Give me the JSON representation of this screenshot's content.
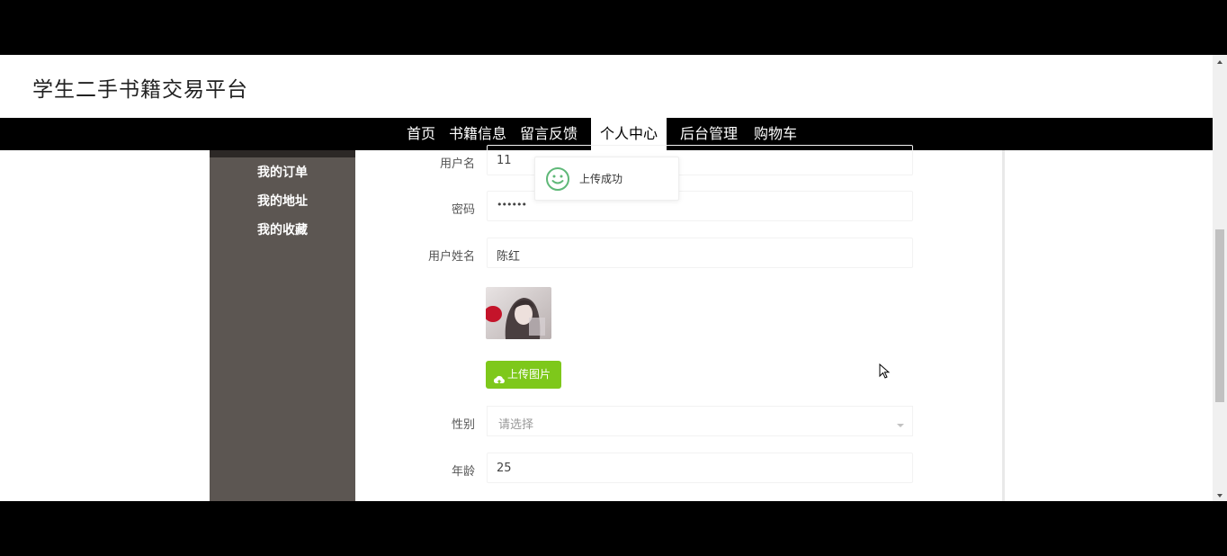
{
  "site": {
    "title": "学生二手书籍交易平台"
  },
  "nav": {
    "items": [
      {
        "label": "首页"
      },
      {
        "label": "书籍信息"
      },
      {
        "label": "留言反馈"
      },
      {
        "label": "个人中心"
      },
      {
        "label": "后台管理"
      },
      {
        "label": "购物车"
      }
    ],
    "active": "个人中心"
  },
  "sidebar": {
    "items": [
      {
        "label": "我的订单"
      },
      {
        "label": "我的地址"
      },
      {
        "label": "我的收藏"
      }
    ]
  },
  "form": {
    "username": {
      "label": "用户名",
      "value": "11"
    },
    "password": {
      "label": "密码",
      "value": "••••••"
    },
    "realname": {
      "label": "用户姓名",
      "value": "陈红"
    },
    "upload_label": "上传图片",
    "gender": {
      "label": "性别",
      "placeholder": "请选择"
    },
    "age": {
      "label": "年龄",
      "value": "25"
    }
  },
  "toast": {
    "text": "上传成功",
    "icon": "smile-icon"
  },
  "colors": {
    "navbar": "#000000",
    "sidebar": "#5c5652",
    "upload_button": "#7ec81b",
    "toast_icon": "#5fb878"
  }
}
